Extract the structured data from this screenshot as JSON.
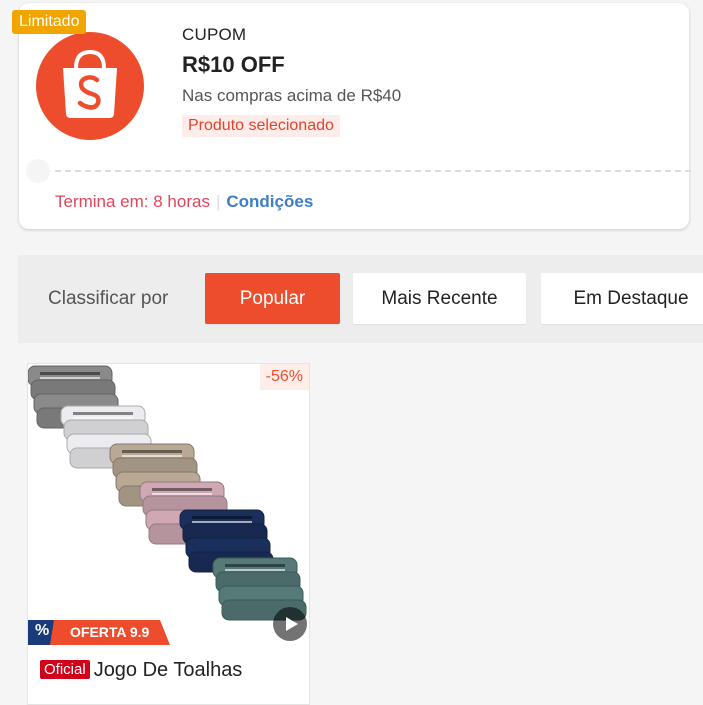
{
  "coupon": {
    "badge": "Limitado",
    "type": "CUPOM",
    "value": "R$10 OFF",
    "condition": "Nas compras acima de R$40",
    "tag": "Produto selecionado",
    "expire": "Termina em: 8 horas",
    "conditions_link": "Condições",
    "logo_icon": "shopee-bag-icon",
    "brand_color": "#ee4d2d"
  },
  "sort": {
    "label": "Classificar por",
    "options": [
      "Popular",
      "Mais Recente",
      "Em Destaque"
    ],
    "active": "Popular"
  },
  "product": {
    "discount": "-56%",
    "promo": "OFERTA 9.9",
    "promo_icon": "percent-icon",
    "official_badge": "Oficial",
    "title": "Jogo De Toalhas",
    "video_icon": "play-icon",
    "towel_colors": [
      "#8a8a8a",
      "#ececf0",
      "#b8a894",
      "#cfa8b4",
      "#1b2f5c",
      "#557a78"
    ]
  }
}
